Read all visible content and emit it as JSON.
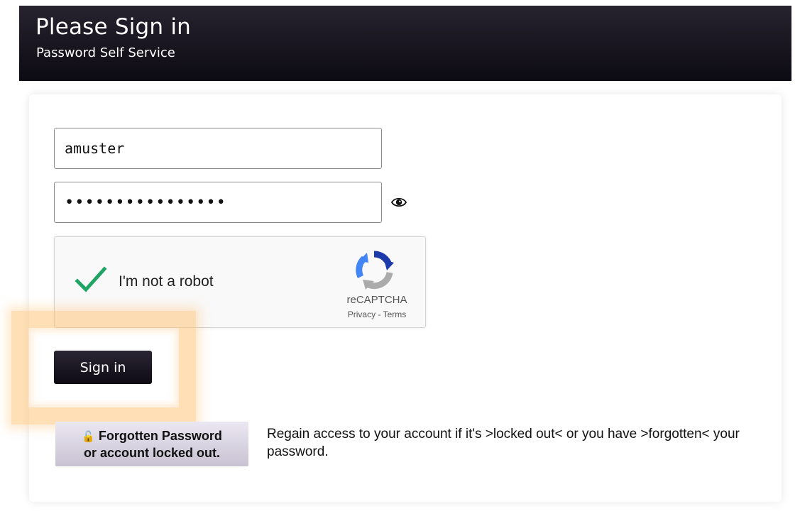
{
  "header": {
    "title": "Please Sign in",
    "subtitle": "Password Self Service"
  },
  "form": {
    "username_value": "amuster",
    "password_value": "••••••••••••••••",
    "show_password_icon": "eye-icon"
  },
  "captcha": {
    "label": "I'm not a robot",
    "checked": true,
    "brand": "reCAPTCHA",
    "privacy_link": "Privacy",
    "separator": " - ",
    "terms_link": "Terms"
  },
  "actions": {
    "sign_in_label": "Sign in",
    "forgot_icon": "🔓",
    "forgot_line1": "Forgotten Password",
    "forgot_line2": "or account locked out.",
    "forgot_description": "Regain access to your account if it's >locked out< or you have >forgotten< your password."
  },
  "colors": {
    "header_bg": "#0c0a12",
    "button_bg": "#1a1620",
    "check_green": "#1fa463",
    "highlight": "#ffc478"
  }
}
